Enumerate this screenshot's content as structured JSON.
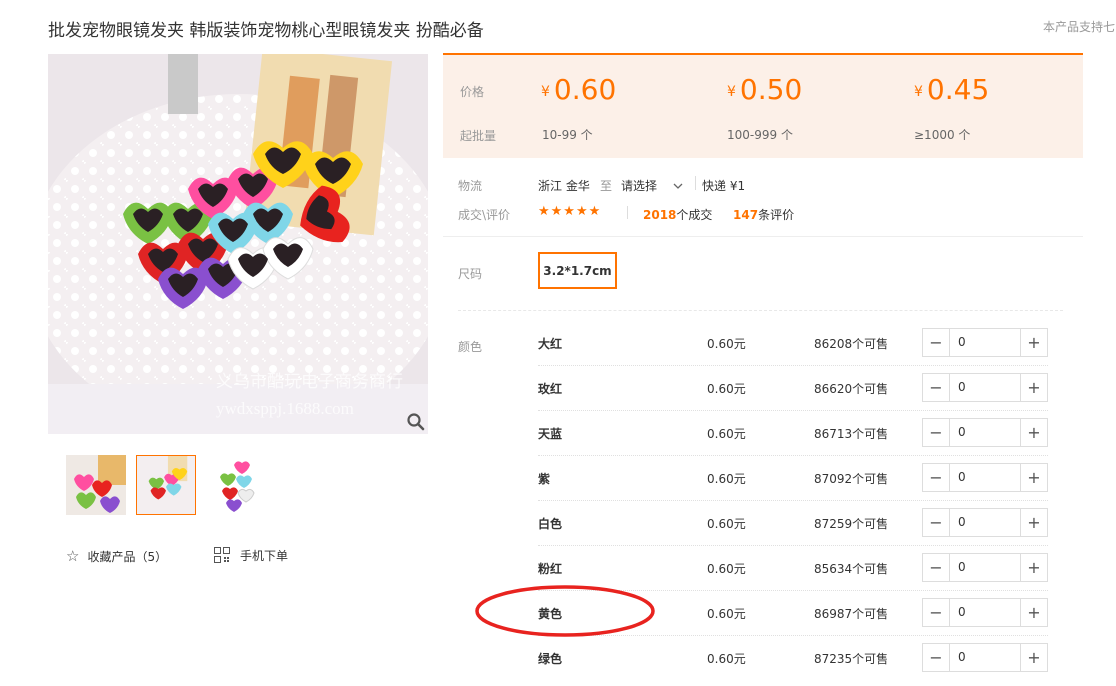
{
  "product": {
    "title": "批发宠物眼镜发夹 韩版装饰宠物桃心型眼镜发夹 扮酷必备",
    "support_text": "本产品支持七",
    "watermark": "义乌市酷玩电子商务商行",
    "watermark_url": "ywdxsppj.1688.com"
  },
  "actions": {
    "favorite_label": "收藏产品（5）",
    "mobile_order_label": "手机下单"
  },
  "price": {
    "label": "价格",
    "min_label": "起批量",
    "currency": "¥",
    "tiers": [
      {
        "price": "0.60",
        "range": "10-99 个"
      },
      {
        "price": "0.50",
        "range": "100-999 个"
      },
      {
        "price": "0.45",
        "range": "≥1000 个"
      }
    ]
  },
  "logistics": {
    "label": "物流",
    "origin": "浙江 金华",
    "to": "至",
    "destination": "请选择",
    "shipping": "快递 ¥1"
  },
  "deals": {
    "label": "成交\\评价",
    "stars": "★★★★★",
    "deal_count": "2018",
    "deal_suffix": "个成交",
    "review_count": "147",
    "review_suffix": "条评价"
  },
  "size": {
    "label": "尺码",
    "option": "3.2*1.7cm"
  },
  "color": {
    "label": "颜色",
    "rows": [
      {
        "name": "大红",
        "price": "0.60元",
        "stock": "86208个可售",
        "qty": "0"
      },
      {
        "name": "玫红",
        "price": "0.60元",
        "stock": "86620个可售",
        "qty": "0"
      },
      {
        "name": "天蓝",
        "price": "0.60元",
        "stock": "86713个可售",
        "qty": "0"
      },
      {
        "name": "紫",
        "price": "0.60元",
        "stock": "87092个可售",
        "qty": "0"
      },
      {
        "name": "白色",
        "price": "0.60元",
        "stock": "87259个可售",
        "qty": "0"
      },
      {
        "name": "粉红",
        "price": "0.60元",
        "stock": "85634个可售",
        "qty": "0"
      },
      {
        "name": "黄色",
        "price": "0.60元",
        "stock": "86987个可售",
        "qty": "0"
      },
      {
        "name": "绿色",
        "price": "0.60元",
        "stock": "87235个可售",
        "qty": "0"
      }
    ]
  },
  "colors": {
    "accent": "#ff7300",
    "price_bg": "#fcf0e8",
    "annotation_circle": "#e8231f"
  },
  "icons": {
    "zoom": "magnifier-icon",
    "favorite": "star-outline-icon",
    "mobile": "qr-code-icon",
    "dropdown": "chevron-down-icon",
    "minus": "minus-icon",
    "plus": "plus-icon"
  }
}
